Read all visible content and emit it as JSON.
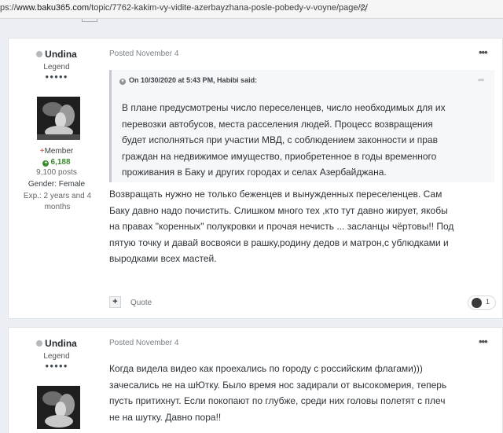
{
  "browser": {
    "url_prefix": "ps://",
    "url_host": "www.baku365.com",
    "url_path": "/topic/7762-kakim-vy-vidite-azerbayzhana-posle-pobedy-v-voyne/page/2/"
  },
  "posts": [
    {
      "author": {
        "name": "Undina",
        "rank": "Legend",
        "pips": "●●●●●",
        "group": "Member",
        "reputation": "6,188",
        "post_count": "9,100 posts",
        "gender": "Gender: Female",
        "experience": "Exp.: 2 years and 4 months"
      },
      "posted": "Posted November 4",
      "quote": {
        "cite": "On 10/30/2020 at 5:43 PM, Habibi said:",
        "lines": [
          "В плане предусмотрены число  переселенцев, число  необходимых для их",
          "перевозки  автобусов, места расселения людей. Процесс возвращения",
          "будет исполняться при участии МВД, с соблюдением законности и прав",
          "граждан на недвижимое имущество, приобретенное в годы временного",
          "проживания в Баку и других городах и селах Азербайджана."
        ]
      },
      "body_lines": [
        "Возвращать нужно не только беженцев и вынужденных переселенцев. Сам",
        "Баку давно надо почистить. Слишком много тех ,кто тут давно жирует, якобы",
        "на правах \"коренных\" полукровки и прочая нечисть ... засланцы чёртовы!! Под",
        "пятую точку и давай восвояси в рашку,родину дедов и матрон,с ублюдками и",
        "выродками всех мастей."
      ],
      "actions": {
        "plus": "+",
        "quote": "Quote",
        "reaction_count": "1"
      }
    },
    {
      "author": {
        "name": "Undina",
        "rank": "Legend",
        "pips": "●●●●●"
      },
      "posted": "Posted November 4",
      "body_lines": [
        "Когда видела видео как проехались по городу с российским флагами)))",
        "зачесались не на шЮтку. Было время нос задирали от высокомерия, теперь",
        "пусть притихнут. Если покопают по глубже, среди них головы полетят с плеч",
        "не на шутку. Давно пора!!"
      ]
    }
  ],
  "icons": {
    "more": "more-horizontal-icon",
    "online": "offline-dot-icon",
    "reputation": "reputation-plus-icon",
    "cite": "chevron-circle-icon",
    "share": "share-icon",
    "reaction": "reaction-emoji-icon"
  },
  "colors": {
    "page_bg": "#ebeef2",
    "reputation_green": "#3a8b2e",
    "member_plus_red": "#c0392b"
  }
}
